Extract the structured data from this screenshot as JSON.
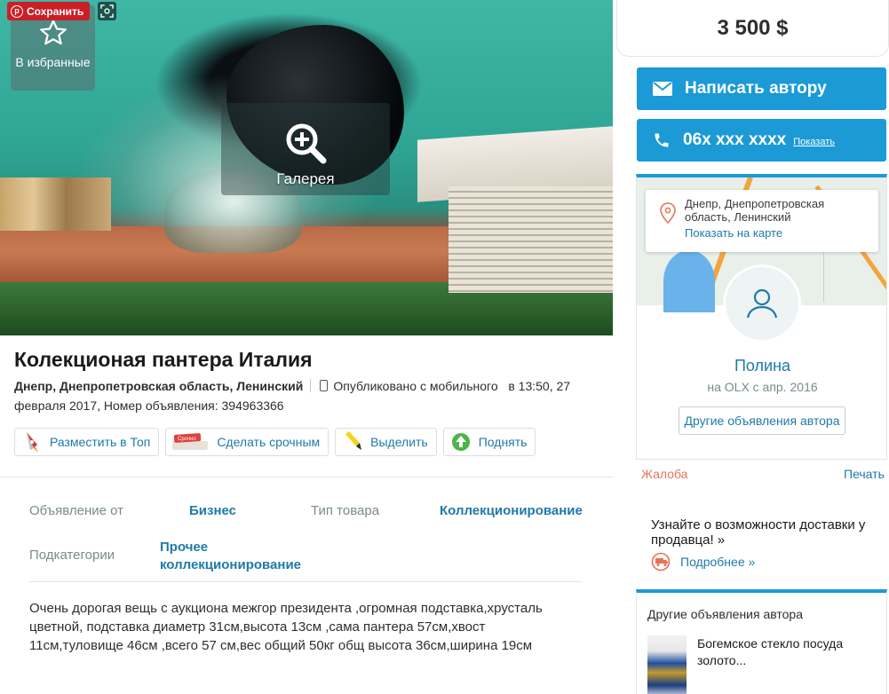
{
  "photo": {
    "pinterest_save": "Сохранить",
    "favorite_label": "В избранные",
    "gallery_label": "Галерея"
  },
  "ad": {
    "title": "Колекционая пантера Италия",
    "location": "Днепр, Днепропетровская область, Ленинский",
    "published_prefix": "Опубликовано с мобильного",
    "published_time": "в 13:50, 27",
    "published_rest": "февраля 2017, Номер объявления: 394963366"
  },
  "actions": [
    {
      "label": "Разместить в Топ",
      "icon": "rocket-icon"
    },
    {
      "label": "Сделать срочным",
      "icon": "urgent-badge-icon",
      "badge": "Срочно"
    },
    {
      "label": "Выделить",
      "icon": "highlighter-icon"
    },
    {
      "label": "Поднять",
      "icon": "raise-icon"
    }
  ],
  "params": {
    "offer_from_label": "Объявление от",
    "offer_from_value": "Бизнес",
    "type_label": "Тип товара",
    "type_value": "Коллекционирование",
    "subcat_label": "Подкатегории",
    "subcat_value_line1": "Прочее",
    "subcat_value_line2": "коллекционирование"
  },
  "description": "Очень дорогая вещь с аукциона межгор президента ,огромная подставка,хрусталь цветной, подставка диаметр 31см,высота 13см ,сама пантера 57см,хвост 11см,туловище 46см ,всего 57 см,вес общий 50кг общ высота 36см,ширина 19см",
  "sidebar": {
    "price": "3 500 $",
    "write_author": "Написать автору",
    "phone_masked": "06x xxx xxxx",
    "phone_show": "Показать",
    "map_location": "Днепр, Днепропетровская область, Ленинский",
    "show_on_map": "Показать на карте",
    "seller_name": "Полина",
    "seller_since": "на OLX с апр. 2016",
    "other_ads_button": "Другие объявления автора",
    "complain": "Жалоба",
    "print": "Печать",
    "delivery_text": "Узнайте о возможности доставки у продавца! »",
    "delivery_more": "Подробнее »",
    "other_ads_head": "Другие объявления автора",
    "other_ad_title": "Богемское стекло посуда золото..."
  },
  "colors": {
    "accent": "#1b9ad6",
    "link": "#1f7aa8",
    "complain": "#e57358",
    "pinterest": "#cb1f27"
  }
}
